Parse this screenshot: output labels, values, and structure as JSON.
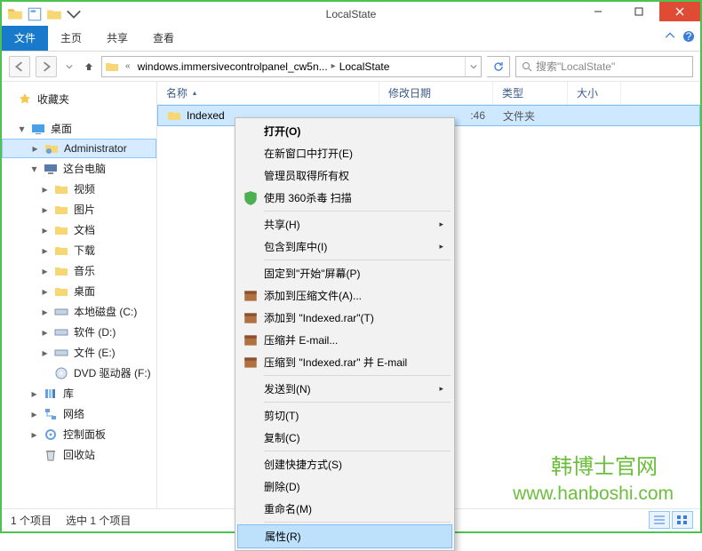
{
  "window": {
    "title": "LocalState"
  },
  "ribbon": {
    "file": "文件",
    "home": "主页",
    "share": "共享",
    "view": "查看"
  },
  "breadcrumb": {
    "part1": "windows.immersivecontrolpanel_cw5n...",
    "part2": "LocalState"
  },
  "search": {
    "placeholder": "搜索\"LocalState\""
  },
  "columns": {
    "name": "名称",
    "date": "修改日期",
    "type": "类型",
    "size": "大小"
  },
  "row": {
    "name": "Indexed",
    "date_tail": ":46",
    "type": "文件夹"
  },
  "nav": {
    "favorites": "收藏夹",
    "desktop": "桌面",
    "admin": "Administrator",
    "thispc": "这台电脑",
    "videos": "视频",
    "pictures": "图片",
    "documents": "文档",
    "downloads": "下载",
    "music": "音乐",
    "desktop2": "桌面",
    "drive_c": "本地磁盘 (C:)",
    "drive_d": "软件 (D:)",
    "drive_e": "文件 (E:)",
    "dvd": "DVD 驱动器 (F:)",
    "libraries": "库",
    "network": "网络",
    "ctrlpanel": "控制面板",
    "recyclebin": "回收站"
  },
  "menu": {
    "open": "打开(O)",
    "open_new": "在新窗口中打开(E)",
    "admin_take": "管理员取得所有权",
    "scan360": "使用 360杀毒 扫描",
    "share": "共享(H)",
    "include_lib": "包含到库中(I)",
    "pin_start": "固定到\"开始\"屏幕(P)",
    "add_archive": "添加到压缩文件(A)...",
    "add_indexed": "添加到 \"Indexed.rar\"(T)",
    "email": "压缩并 E-mail...",
    "email_indexed": "压缩到 \"Indexed.rar\" 并 E-mail",
    "sendto": "发送到(N)",
    "cut": "剪切(T)",
    "copy": "复制(C)",
    "shortcut": "创建快捷方式(S)",
    "delete": "删除(D)",
    "rename": "重命名(M)",
    "properties": "属性(R)"
  },
  "status": {
    "count": "1 个项目",
    "selected": "选中 1 个项目"
  },
  "watermark": {
    "line1": "韩博士官网",
    "line2": "www.hanboshi.com"
  }
}
